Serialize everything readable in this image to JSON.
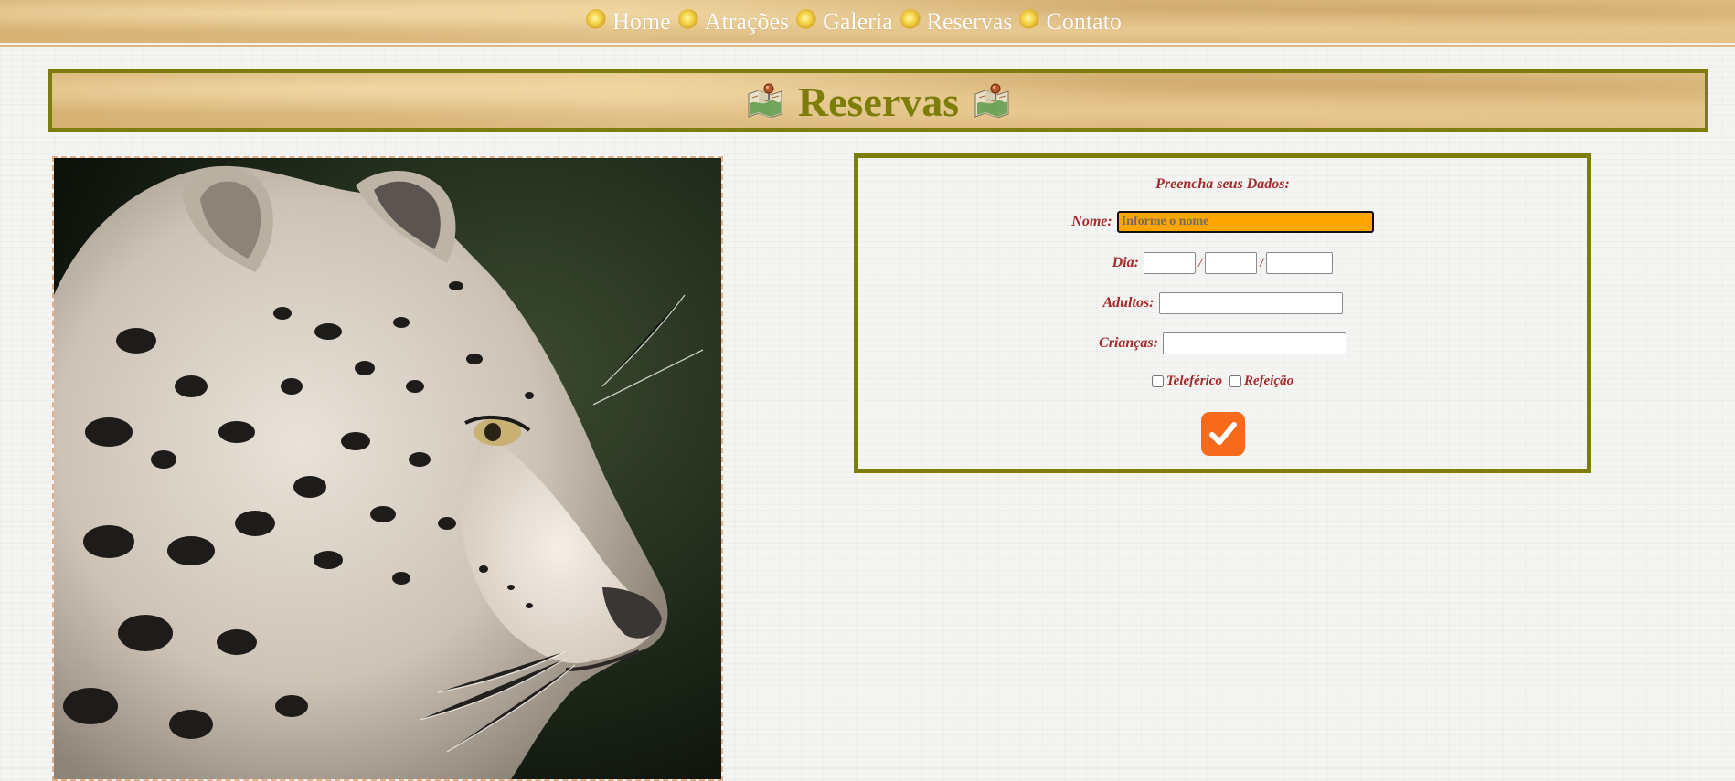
{
  "nav": {
    "items": [
      {
        "label": "Home"
      },
      {
        "label": "Atrações"
      },
      {
        "label": "Galeria"
      },
      {
        "label": "Reservas"
      },
      {
        "label": "Contato"
      }
    ],
    "bullet_icon": "sun-bullet-icon"
  },
  "page": {
    "title": "Reservas",
    "title_icon": "map-pin-icon",
    "photo_subject": "snow-leopard-photo"
  },
  "form": {
    "heading": "Preencha seus Dados:",
    "name_label": "Nome:",
    "name_placeholder": "Informe o nome",
    "name_value": "",
    "day_label": "Dia:",
    "date_separator": "/",
    "adults_label": "Adultos:",
    "children_label": "Crianças:",
    "options": [
      {
        "label": "Teleférico",
        "checked": false
      },
      {
        "label": "Refeição",
        "checked": false
      }
    ],
    "submit_icon": "checkmark-icon"
  },
  "colors": {
    "accent_olive": "#7d7d0a",
    "label_red": "#a52a2a",
    "name_field_bg": "#ffa500",
    "submit_orange": "#f76a1c",
    "parchment": "#dcba7e"
  }
}
